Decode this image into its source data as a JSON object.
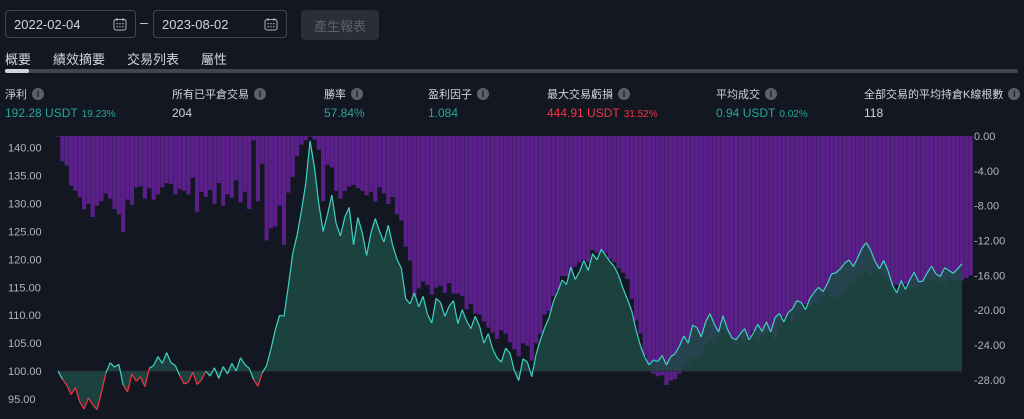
{
  "date_range": {
    "start": "2022-02-04",
    "end": "2023-08-02",
    "separator": "–",
    "generate_label": "產生報表"
  },
  "tabs": [
    "概要",
    "績效摘要",
    "交易列表",
    "屬性"
  ],
  "stats": {
    "net_profit": {
      "label": "淨利",
      "value": "192.28 USDT",
      "pct": "19.23%"
    },
    "closed_trades": {
      "label": "所有已平倉交易",
      "value": "204"
    },
    "win_rate": {
      "label": "勝率",
      "value": "57.84%"
    },
    "profit_factor": {
      "label": "盈利因子",
      "value": "1.084"
    },
    "max_drawdown": {
      "label": "最大交易虧損",
      "value": "444.91 USDT",
      "pct": "31.52%"
    },
    "avg_trade": {
      "label": "平均成交",
      "value": "0.94 USDT",
      "pct": "0.02%"
    },
    "avg_bars": {
      "label": "全部交易的平均持倉K線根數",
      "value": "118"
    }
  },
  "colors": {
    "background": "#131722",
    "green": "#26a69a",
    "red": "#f23645",
    "drawdown": "#5b1f8a",
    "equity_line": "#3fd3c4",
    "equity_fill": "#1e4a44"
  },
  "chart_data": {
    "type": "area",
    "series": [
      {
        "name": "",
        "values": [
          100.0,
          98.6,
          97.5,
          95.8,
          97.0,
          94.5,
          93.2,
          95.2,
          94.0,
          93.1,
          96.2,
          99.6,
          101.5,
          100.7,
          101.2,
          97.5,
          96.3,
          99.5,
          98.2,
          99.0,
          97.2,
          100.5,
          101.0,
          102.6,
          101.4,
          103.3,
          101.5,
          101.0,
          99.2,
          97.7,
          98.0,
          99.8,
          97.6,
          98.4,
          100.0,
          99.1,
          100.6,
          98.7,
          100.8,
          99.5,
          101.4,
          100.0,
          102.4,
          101.2,
          100.5,
          98.5,
          97.3,
          99.7,
          101.0,
          104.0,
          107.4,
          110.0,
          109.8,
          115.2,
          121.0,
          124.3,
          128.6,
          133.6,
          141.2,
          136.5,
          130.0,
          125.0,
          128.0,
          131.5,
          126.4,
          124.2,
          127.6,
          129.3,
          122.6,
          127.5,
          124.8,
          120.7,
          124.7,
          127.3,
          125.0,
          123.1,
          126.1,
          122.5,
          120.0,
          118.4,
          113.0,
          112.0,
          114.0,
          111.5,
          113.4,
          110.2,
          108.6,
          113.0,
          112.3,
          109.8,
          111.6,
          112.6,
          108.5,
          111.0,
          109.0,
          107.6,
          109.8,
          108.0,
          105.0,
          106.7,
          104.0,
          102.4,
          101.6,
          104.1,
          103.2,
          100.1,
          98.3,
          102.2,
          101.6,
          99.0,
          103.0,
          105.6,
          107.8,
          109.6,
          112.5,
          114.3,
          116.3,
          115.5,
          118.6,
          116.4,
          117.8,
          119.8,
          118.0,
          121.0,
          119.9,
          121.8,
          120.7,
          119.6,
          118.7,
          117.1,
          114.8,
          112.9,
          110.8,
          107.4,
          104.6,
          102.5,
          101.1,
          102.0,
          101.7,
          102.8,
          101.1,
          102.6,
          103.1,
          104.5,
          106.3,
          105.0,
          108.2,
          107.8,
          106.1,
          108.8,
          110.3,
          108.4,
          107.0,
          109.9,
          107.6,
          106.0,
          105.6,
          106.7,
          107.6,
          105.6,
          106.8,
          108.4,
          107.1,
          108.8,
          107.0,
          109.6,
          110.3,
          108.8,
          110.5,
          111.1,
          112.6,
          112.3,
          111.0,
          113.0,
          114.1,
          115.0,
          114.2,
          115.6,
          117.4,
          117.6,
          118.3,
          119.3,
          119.9,
          118.7,
          120.3,
          122.0,
          123.0,
          121.6,
          119.6,
          118.3,
          119.8,
          117.9,
          115.4,
          114.0,
          116.2,
          114.6,
          116.3,
          117.7,
          116.0,
          116.1,
          117.6,
          118.8,
          117.4,
          116.9,
          118.5,
          118.0,
          117.5,
          118.3,
          119.2
        ]
      },
      {
        "name": "",
        "values": [
          0,
          -2.9,
          -3.4,
          -5.7,
          -6.3,
          -7.0,
          -8.4,
          -7.8,
          -9.3,
          -8.0,
          -7.5,
          -6.6,
          -7.2,
          -8.4,
          -9.0,
          -11.0,
          -7.3,
          -7.9,
          -5.9,
          -5.8,
          -7.2,
          -6.0,
          -7.3,
          -6.7,
          -5.9,
          -5.4,
          -5.5,
          -6.7,
          -6.1,
          -6.3,
          -6.7,
          -4.8,
          -8.7,
          -6.4,
          -7.0,
          -6.2,
          -7.8,
          -5.4,
          -8.0,
          -6.7,
          -7.1,
          -5.1,
          -7.6,
          -6.4,
          -8.4,
          -0.5,
          -7.5,
          -3.2,
          -12.0,
          -10.6,
          -10.4,
          -8.0,
          -12.5,
          -6.5,
          -4.7,
          -2.3,
          -1.0,
          -0.5,
          0,
          -0.4,
          -1.6,
          -7.5,
          -3.3,
          -3.6,
          -6.3,
          -7.2,
          -6.3,
          -5.8,
          -5.6,
          -6.0,
          -6.3,
          -6.8,
          -6.4,
          -7.5,
          -5.9,
          -6.6,
          -7.8,
          -7.0,
          -9.0,
          -9.7,
          -12.7,
          -14.3,
          -18.4,
          -17.5,
          -16.7,
          -17.1,
          -18.2,
          -17.4,
          -17.2,
          -18.0,
          -16.9,
          -18.1,
          -18.1,
          -18.4,
          -19.9,
          -19.3,
          -20.4,
          -20.5,
          -21.3,
          -22.0,
          -22.6,
          -23.3,
          -22.3,
          -22.7,
          -23.7,
          -24.5,
          -25.3,
          -23.8,
          -24.1,
          -25.8,
          -23.8,
          -22.7,
          -20.5,
          -20.1,
          -18.4,
          -17.7,
          -16.1,
          -16.1,
          -15.8,
          -15.0,
          -14.5,
          -14.2,
          -14.5,
          -13.1,
          -13.4,
          -13.4,
          -13.4,
          -14.1,
          -14.5,
          -15.2,
          -15.7,
          -16.4,
          -18.7,
          -21.2,
          -22.7,
          -25.2,
          -26.3,
          -27.3,
          -27.6,
          -27.5,
          -28.6,
          -28.1,
          -27.9,
          -27.3,
          -26.4,
          -26.1,
          -25.5,
          -25.6,
          -25.1,
          -24.1,
          -23.4,
          -23.9,
          -23.2,
          -22.3,
          -22.7,
          -23.3,
          -24.2,
          -23.4,
          -24.0,
          -23.1,
          -22.4,
          -23.6,
          -23.1,
          -22.7,
          -22.3,
          -23.3,
          -21.9,
          -20.8,
          -20.7,
          -21.4,
          -20.3,
          -20.4,
          -19.3,
          -19.5,
          -19.2,
          -19.3,
          -18.5,
          -17.9,
          -18.5,
          -18.7,
          -18.6,
          -17.7,
          -17.0,
          -17.0,
          -16.0,
          -15.8,
          -15.4,
          -16.0,
          -15.2,
          -15.4,
          -16.1,
          -16.7,
          -17.2,
          -17.1,
          -18.2,
          -17.0,
          -17.3,
          -17.4,
          -17.3,
          -16.8,
          -16.3,
          -16.7,
          -16.3,
          -16.8,
          -16.9,
          -16.3,
          -16.6,
          -16.6,
          -16.6,
          -16.3,
          -16.0
        ]
      }
    ],
    "left_ticks": [
      "95.00",
      "100.00",
      "105.00",
      "110.00",
      "115.00",
      "120.00",
      "125.00",
      "130.00",
      "135.00",
      "140.00"
    ],
    "right_ticks": [
      "0.00",
      "-4.00",
      "-8.00",
      "-12.00",
      "-16.00",
      "-20.00",
      "-24.00",
      "-28.00"
    ],
    "ylim_left": [
      92.5,
      141.0
    ],
    "ylim_right": [
      -32.5,
      0
    ],
    "baseline": 100,
    "grid": false
  }
}
